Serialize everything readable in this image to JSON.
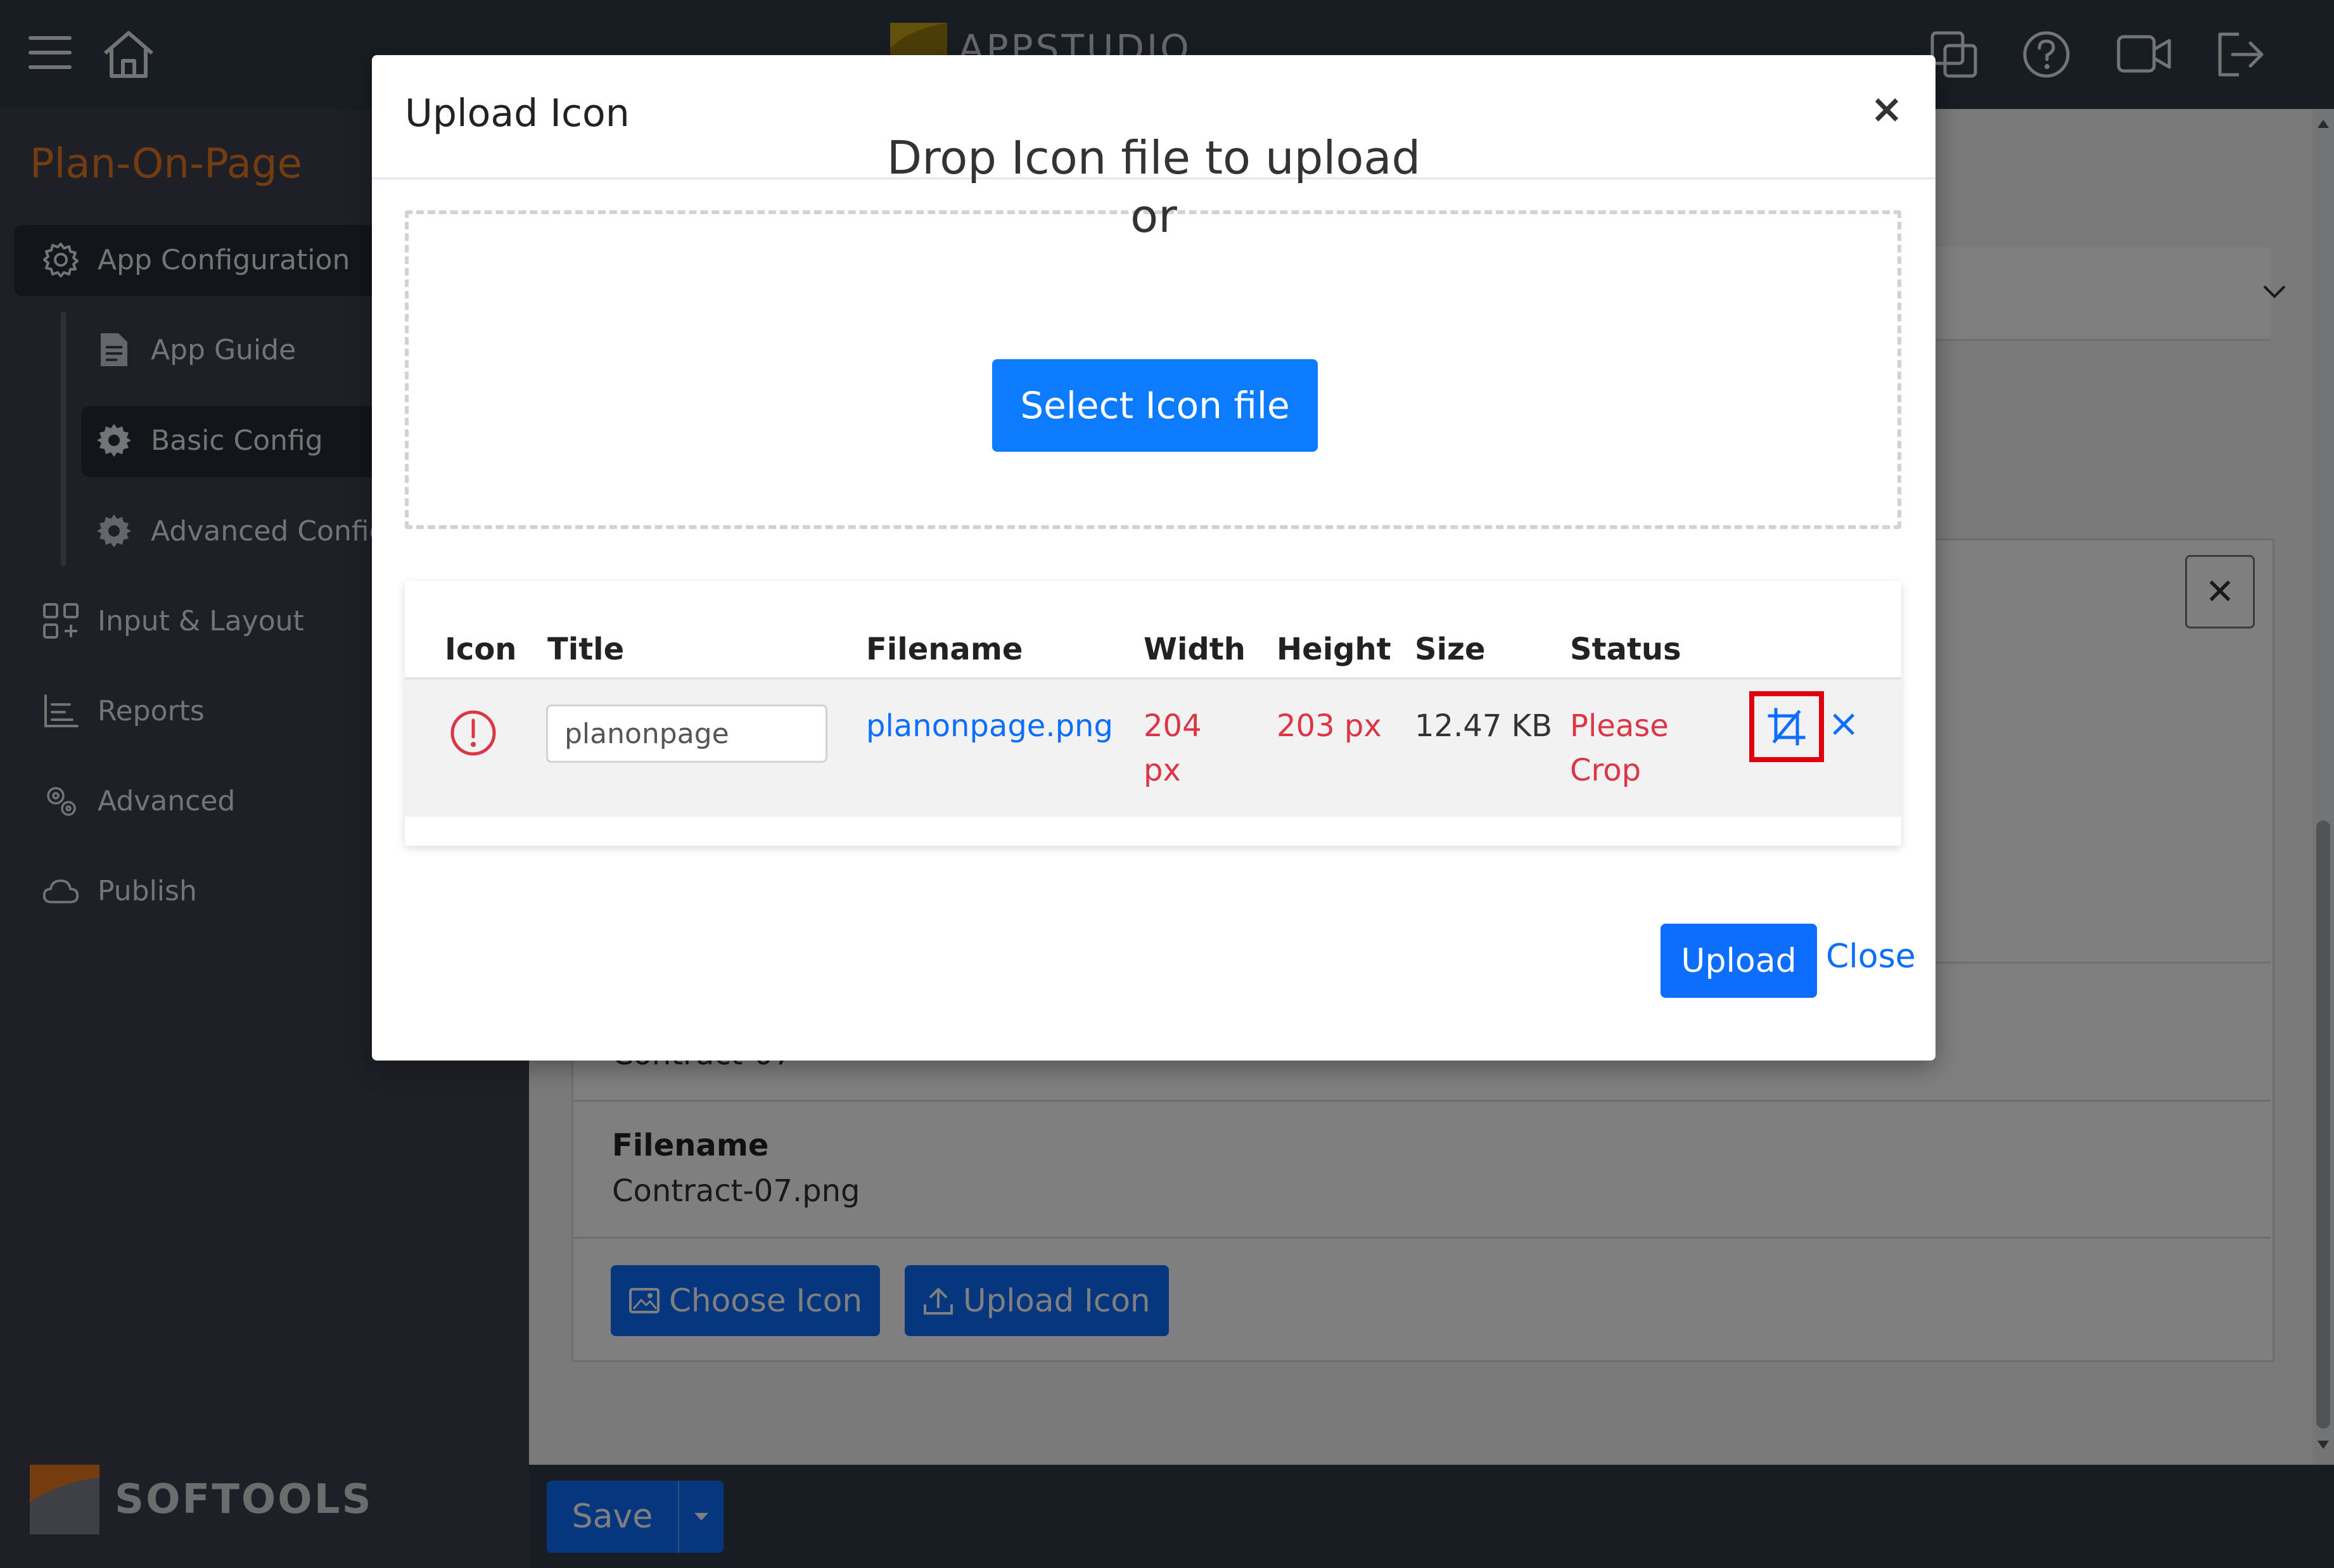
{
  "header": {
    "logo_text": "APPSTUDIO"
  },
  "sidebar": {
    "app_name": "Plan-On-Page",
    "items": [
      {
        "label": "App Configuration",
        "icon": "gear-outline-icon"
      },
      {
        "label": "App Guide",
        "icon": "document-icon"
      },
      {
        "label": "Basic Config",
        "icon": "gear-icon"
      },
      {
        "label": "Advanced Config",
        "icon": "gear-icon"
      },
      {
        "label": "Input & Layout",
        "icon": "grid-plus-icon"
      },
      {
        "label": "Reports",
        "icon": "report-icon"
      },
      {
        "label": "Advanced",
        "icon": "gears-icon"
      },
      {
        "label": "Publish",
        "icon": "cloud-icon"
      }
    ],
    "company": "SOFTOOLS"
  },
  "background_card": {
    "partial_value": "Contract-07",
    "filename_label": "Filename",
    "filename_value": "Contract-07.png",
    "choose_icon_label": "Choose Icon",
    "upload_icon_label": "Upload Icon"
  },
  "footer": {
    "save_label": "Save"
  },
  "modal": {
    "title": "Upload Icon",
    "close_symbol": "×",
    "dropzone": {
      "line1": "Drop Icon file to upload",
      "line2": "or",
      "select_button": "Select Icon file"
    },
    "table": {
      "headers": [
        "Icon",
        "Title",
        "Filename",
        "Width",
        "Height",
        "Size",
        "Status"
      ],
      "rows": [
        {
          "title_value": "planonpage",
          "filename": "planonpage.png",
          "width_value": "204",
          "width_unit": "px",
          "height": "203 px",
          "size": "12.47 KB",
          "status_line1": "Please",
          "status_line2": "Crop",
          "remove_symbol": "×"
        }
      ]
    },
    "upload_button": "Upload",
    "close_link": "Close"
  },
  "colors": {
    "primary": "#0d6efd",
    "error": "#dc3545",
    "highlight": "#e0000d",
    "brand_orange": "#e8781e",
    "dark_bar": "#313a46"
  }
}
